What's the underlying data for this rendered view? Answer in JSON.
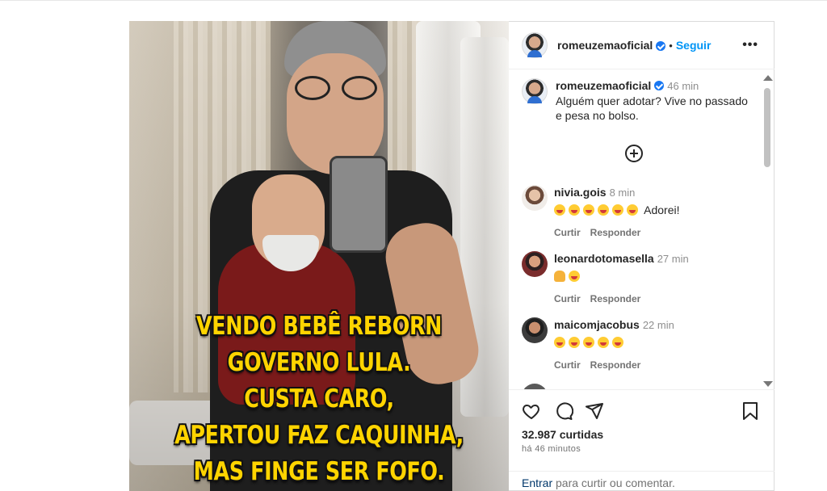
{
  "post": {
    "image": {
      "caption_lines": [
        "VENDO BEBÊ REBORN",
        "GOVERNO LULA.",
        "CUSTA CARO,",
        "APERTOU FAZ CAQUINHA,",
        "MAS FINGE SER FOFO."
      ]
    },
    "header": {
      "username": "romeuzemaoficial",
      "dot": "•",
      "follow_label": "Seguir",
      "more_label": "•••"
    },
    "caption": {
      "username": "romeuzemaoficial",
      "time": "46 min",
      "text": "Alguém quer adotar? Vive no passado e pesa no bolso."
    },
    "comments": [
      {
        "username": "nivia.gois",
        "time": "8 min",
        "text": "Adorei!",
        "emojis": 6,
        "like_label": "Curtir",
        "reply_label": "Responder"
      },
      {
        "username": "leonardotomasella",
        "time": "27 min",
        "text": "",
        "emojis": 1,
        "like_label": "Curtir",
        "reply_label": "Responder"
      },
      {
        "username": "maicomjacobus",
        "time": "22 min",
        "text": "",
        "emojis": 5,
        "like_label": "Curtir",
        "reply_label": "Responder"
      }
    ],
    "likes": "32.987 curtidas",
    "posted_ago": "há 46 minutos",
    "add_comment": {
      "login_label": "Entrar",
      "rest": " para curtir ou comentar."
    },
    "colors": {
      "accent": "#0095f6",
      "verified": "#1877f2",
      "caption_yellow": "#ffd400"
    },
    "icons": [
      "more-icon",
      "add-circle-icon",
      "heart-icon",
      "comment-icon",
      "share-icon",
      "bookmark-icon",
      "verified-icon"
    ]
  }
}
